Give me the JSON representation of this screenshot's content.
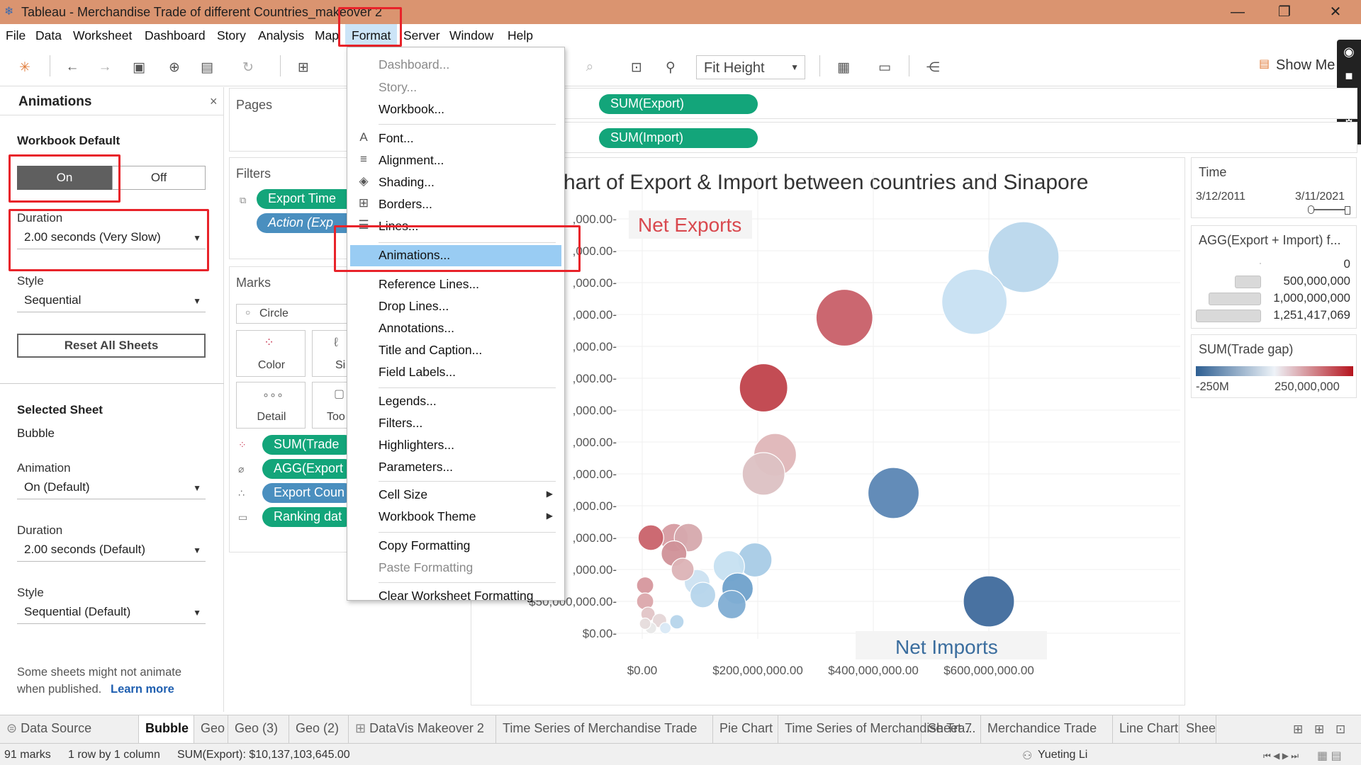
{
  "window": {
    "title": "Tableau - Merchandise Trade of different Countries_makeover 2",
    "minimize": "—",
    "restore": "❐",
    "close": "✕"
  },
  "menubar": [
    "File",
    "Data",
    "Worksheet",
    "Dashboard",
    "Story",
    "Analysis",
    "Map",
    "Format",
    "Server",
    "Window",
    "Help"
  ],
  "toolbar": {
    "fit": "Fit Height",
    "show_me": "Show Me"
  },
  "animations_panel": {
    "title": "Animations",
    "close": "×",
    "workbook_default": "Workbook Default",
    "on": "On",
    "off": "Off",
    "duration_label": "Duration",
    "duration_value": "2.00 seconds (Very Slow)",
    "style_label": "Style",
    "style_value": "Sequential",
    "reset": "Reset All Sheets",
    "selected_sheet_label": "Selected Sheet",
    "selected_sheet_value": "Bubble",
    "animation_label": "Animation",
    "animation_value": "On (Default)",
    "duration2_label": "Duration",
    "duration2_value": "2.00 seconds (Default)",
    "style2_label": "Style",
    "style2_value": "Sequential (Default)",
    "note": "Some sheets might not animate",
    "note2": "when published.",
    "learn_more": "Learn more"
  },
  "cards": {
    "pages": "Pages",
    "filters": "Filters",
    "filter_pills": [
      "Export Time",
      "Action (Exp"
    ],
    "marks": "Marks",
    "mark_type": "Circle",
    "color": "Color",
    "size": "Si",
    "detail": "Detail",
    "tooltip": "Too",
    "mark_pills": [
      "SUM(Trade",
      "AGG(Export",
      "Export Coun",
      "Ranking dat"
    ]
  },
  "shelves": {
    "columns_pill": "SUM(Export)",
    "rows_pill": "SUM(Import)"
  },
  "format_menu": {
    "items": [
      {
        "label": "Dashboard...",
        "disabled": true
      },
      {
        "label": "Story...",
        "disabled": true
      },
      {
        "label": "Workbook...",
        "disabled": false
      },
      {
        "label": "Font...",
        "icon": "A"
      },
      {
        "label": "Alignment...",
        "icon": "≡"
      },
      {
        "label": "Shading...",
        "icon": "◈"
      },
      {
        "label": "Borders...",
        "icon": "⊞"
      },
      {
        "label": "Lines...",
        "icon": "☰"
      },
      {
        "label": "Animations..."
      },
      {
        "label": "Reference Lines..."
      },
      {
        "label": "Drop Lines..."
      },
      {
        "label": "Annotations..."
      },
      {
        "label": "Title and Caption..."
      },
      {
        "label": "Field Labels..."
      },
      {
        "label": "Legends..."
      },
      {
        "label": "Filters..."
      },
      {
        "label": "Highlighters..."
      },
      {
        "label": "Parameters..."
      },
      {
        "label": "Cell Size"
      },
      {
        "label": "Workbook Theme"
      },
      {
        "label": "Copy Formatting"
      },
      {
        "label": "Paste Formatting",
        "disabled": true
      },
      {
        "label": "Clear Worksheet Formatting"
      }
    ]
  },
  "chart_data": {
    "type": "scatter",
    "title": "hart of Export & Import between  countries and Sinapore",
    "annotation_top": "Net Exports",
    "annotation_bottom": "Net Imports",
    "x_ticks": [
      "$0.00",
      "$200,000,000.00",
      "$400,000,000.00",
      "$600,000,000.00"
    ],
    "y_ticks": [
      ",000.00-",
      ",000.00-",
      ",000.00-",
      ",000.00-",
      ",000.00-",
      ",000.00-",
      ",000.00-",
      ",000.00-",
      ",000.00-",
      ",000.00-",
      ",000.00-",
      ",000.00-",
      "$50,000,000.00-",
      "$0.00-"
    ],
    "xlim": [
      0,
      700000000
    ],
    "ylim": [
      0,
      650000000
    ],
    "grid": true,
    "points": [
      {
        "x": 660000000,
        "y": 590000000,
        "size": 1.25,
        "color": "#b9d7ec"
      },
      {
        "x": 575000000,
        "y": 520000000,
        "size": 1.15,
        "color": "#c7e0f2"
      },
      {
        "x": 350000000,
        "y": 495000000,
        "size": 1.0,
        "color": "#c85f68"
      },
      {
        "x": 210000000,
        "y": 385000000,
        "size": 0.85,
        "color": "#c0424b"
      },
      {
        "x": 230000000,
        "y": 280000000,
        "size": 0.75,
        "color": "#dfb6b8"
      },
      {
        "x": 210000000,
        "y": 250000000,
        "size": 0.75,
        "color": "#dcc1c3"
      },
      {
        "x": 435000000,
        "y": 220000000,
        "size": 0.9,
        "color": "#5b86b4"
      },
      {
        "x": 600000000,
        "y": 50000000,
        "size": 0.9,
        "color": "#3f6a9c"
      },
      {
        "x": 195000000,
        "y": 115000000,
        "size": 0.6,
        "color": "#a8cbe6"
      },
      {
        "x": 150000000,
        "y": 105000000,
        "size": 0.55,
        "color": "#c6e0f1"
      },
      {
        "x": 165000000,
        "y": 70000000,
        "size": 0.55,
        "color": "#6fa1cb"
      },
      {
        "x": 155000000,
        "y": 45000000,
        "size": 0.5,
        "color": "#7fadd3"
      },
      {
        "x": 95000000,
        "y": 80000000,
        "size": 0.45,
        "color": "#cce2f1"
      },
      {
        "x": 105000000,
        "y": 60000000,
        "size": 0.45,
        "color": "#b6d5eb"
      },
      {
        "x": 55000000,
        "y": 150000000,
        "size": 0.5,
        "color": "#d69ba1"
      },
      {
        "x": 80000000,
        "y": 150000000,
        "size": 0.5,
        "color": "#d6a9ad"
      },
      {
        "x": 15000000,
        "y": 150000000,
        "size": 0.45,
        "color": "#c9626a"
      },
      {
        "x": 55000000,
        "y": 125000000,
        "size": 0.45,
        "color": "#d09198"
      },
      {
        "x": 70000000,
        "y": 100000000,
        "size": 0.4,
        "color": "#dcb3b6"
      },
      {
        "x": 5000000,
        "y": 75000000,
        "size": 0.3,
        "color": "#d6979d"
      },
      {
        "x": 5000000,
        "y": 50000000,
        "size": 0.3,
        "color": "#dba7ab"
      },
      {
        "x": 10000000,
        "y": 30000000,
        "size": 0.25,
        "color": "#e2c4c6"
      },
      {
        "x": 30000000,
        "y": 20000000,
        "size": 0.25,
        "color": "#e5d6d7"
      },
      {
        "x": 60000000,
        "y": 18000000,
        "size": 0.25,
        "color": "#b6d5eb"
      },
      {
        "x": 40000000,
        "y": 8000000,
        "size": 0.2,
        "color": "#d9e9f5"
      },
      {
        "x": 15000000,
        "y": 8000000,
        "size": 0.2,
        "color": "#e8e8e8"
      },
      {
        "x": 5000000,
        "y": 15000000,
        "size": 0.2,
        "color": "#e6dcdc"
      }
    ]
  },
  "legends": {
    "time_title": "Time",
    "time_start": "3/12/2011",
    "time_end": "3/11/2021",
    "size_title": "AGG(Export + Import) f...",
    "size_items": [
      {
        "label": "0",
        "fraction": 0.0
      },
      {
        "label": "500,000,000",
        "fraction": 0.4
      },
      {
        "label": "1,000,000,000",
        "fraction": 0.8
      },
      {
        "label": "1,251,417,069",
        "fraction": 1.0
      }
    ],
    "color_title": "SUM(Trade gap)",
    "color_min": "-250M",
    "color_max": "250,000,000",
    "color_low": "#2e5f92",
    "color_mid": "#eef3f8",
    "color_high": "#b5141d"
  },
  "tabs": [
    "Data Source",
    "Bubble",
    "Geo",
    "Geo (3)",
    "Geo (2)",
    "DataVis Makeover 2",
    "Time Series of Merchandise Trade",
    "Pie Chart",
    "Time Series of Merchandise Tra...",
    "Sheet 7",
    "Merchandice Trade",
    "Line Chart",
    "Shee"
  ],
  "status": {
    "marks": "91 marks",
    "rows": "1 row by 1 column",
    "sum": "SUM(Export): $10,137,103,645.00",
    "user": "Yueting Li"
  }
}
